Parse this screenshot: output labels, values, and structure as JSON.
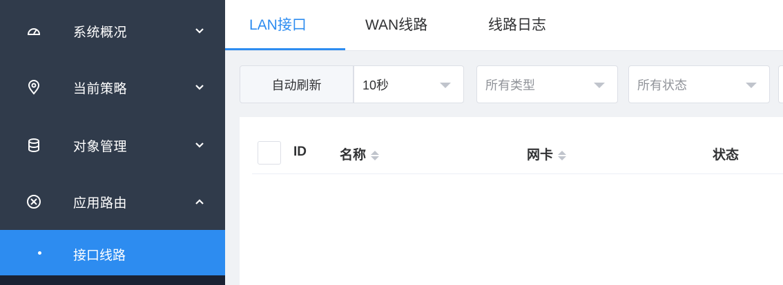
{
  "sidebar": {
    "items": [
      {
        "label": "系统概况",
        "icon": "dashboard-gauge-icon",
        "expanded": false
      },
      {
        "label": "当前策略",
        "icon": "location-pin-icon",
        "expanded": false
      },
      {
        "label": "对象管理",
        "icon": "database-icon",
        "expanded": false
      },
      {
        "label": "应用路由",
        "icon": "route-circle-x-icon",
        "expanded": true
      }
    ],
    "sub_items": [
      {
        "label": "接口线路",
        "active": true
      }
    ]
  },
  "tabs": [
    {
      "label": "LAN接口",
      "active": true
    },
    {
      "label": "WAN线路",
      "active": false
    },
    {
      "label": "线路日志",
      "active": false
    }
  ],
  "toolbar": {
    "refresh_label": "自动刷新",
    "interval_value": "10秒",
    "type_placeholder": "所有类型",
    "status_placeholder": "所有状态"
  },
  "table": {
    "columns": [
      "ID",
      "名称",
      "网卡",
      "状态"
    ]
  },
  "colors": {
    "sidebar_bg": "#303b4b",
    "accent": "#2d8cf0",
    "page_bg": "#f0f2f5"
  }
}
